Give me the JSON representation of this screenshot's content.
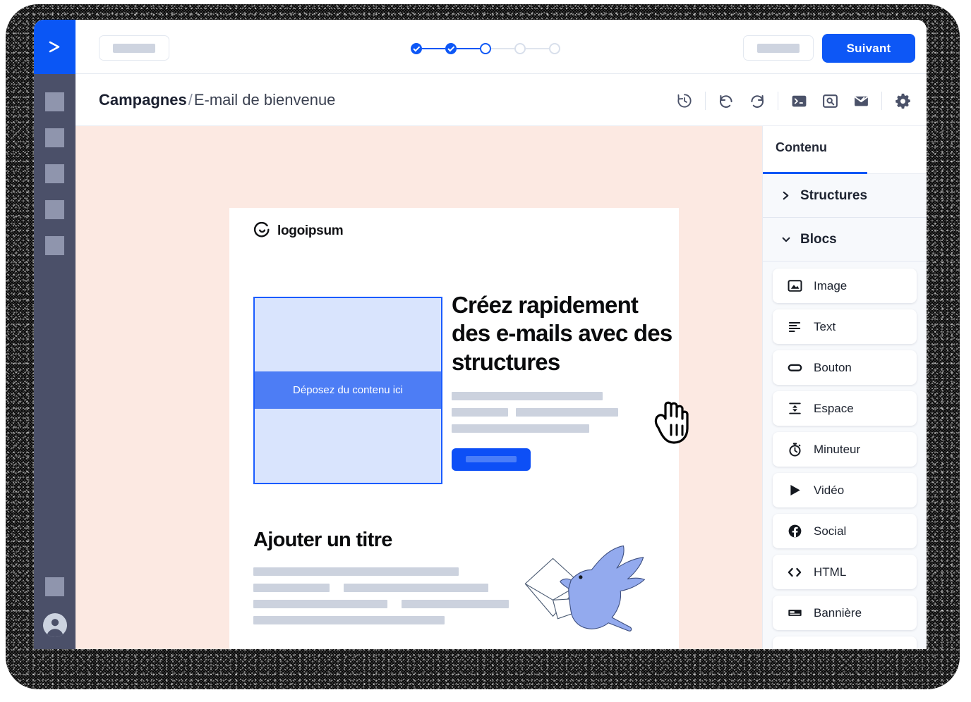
{
  "brand": {
    "logo_icon": "chevron-right-logo"
  },
  "topbar": {
    "left_button_placeholder": "",
    "right_button_placeholder": "",
    "next_label": "Suivant",
    "stepper": {
      "total_steps": 5,
      "steps": [
        {
          "state": "done"
        },
        {
          "state": "done"
        },
        {
          "state": "active"
        },
        {
          "state": "todo"
        },
        {
          "state": "todo"
        }
      ]
    }
  },
  "header": {
    "breadcrumb_root": "Campagnes",
    "breadcrumb_separator": "/",
    "breadcrumb_leaf": "E-mail de bienvenue",
    "tools": [
      {
        "name": "history-icon",
        "title": "Historique"
      },
      {
        "name": "undo-icon",
        "title": "Annuler"
      },
      {
        "name": "redo-icon",
        "title": "Rétablir"
      },
      {
        "name": "terminal-icon",
        "title": "Code"
      },
      {
        "name": "preview-icon",
        "title": "Aperçu"
      },
      {
        "name": "envelope-check-icon",
        "title": "Test"
      },
      {
        "name": "gear-icon",
        "title": "Paramètres"
      }
    ]
  },
  "rail": {
    "items": [
      {
        "name": "rail-item-1"
      },
      {
        "name": "rail-item-2"
      },
      {
        "name": "rail-item-3"
      },
      {
        "name": "rail-item-4"
      },
      {
        "name": "rail-item-5"
      },
      {
        "name": "rail-item-6"
      }
    ],
    "avatar_icon": "user-avatar-icon"
  },
  "canvas": {
    "background_color": "#fce9e2",
    "email": {
      "logo_text": "logoipsum",
      "logo_icon": "circle-arc-logo",
      "dropzone_label": "Déposez du contenu ici",
      "hero_heading": "Créez rapidement des e-mails avec des structures",
      "hero_bar_rows": [
        [
          214
        ],
        [
          80,
          145
        ],
        [
          195
        ]
      ],
      "cta_button_placeholder": "",
      "section_heading": "Ajouter un titre",
      "section_bar_rows": [
        [
          291
        ],
        [
          108,
          205
        ],
        [
          190,
          152
        ],
        [
          271
        ]
      ],
      "illustration": "bird-carrying-envelope"
    },
    "cursor_icon": "pointing-hand-cursor"
  },
  "panel": {
    "tab_label": "Contenu",
    "accordions": [
      {
        "label": "Structures",
        "expanded": false,
        "chevron": "chevron-right-icon"
      },
      {
        "label": "Blocs",
        "expanded": true,
        "chevron": "chevron-down-icon"
      }
    ],
    "blocks": [
      {
        "label": "Image",
        "icon": "image-icon"
      },
      {
        "label": "Text",
        "icon": "text-lines-icon"
      },
      {
        "label": "Bouton",
        "icon": "button-pill-icon"
      },
      {
        "label": "Espace",
        "icon": "spacer-arrows-icon"
      },
      {
        "label": "Minuteur",
        "icon": "timer-icon"
      },
      {
        "label": "Vidéo",
        "icon": "play-triangle-icon"
      },
      {
        "label": "Social",
        "icon": "facebook-icon"
      },
      {
        "label": "HTML",
        "icon": "code-brackets-icon"
      },
      {
        "label": "Bannière",
        "icon": "banner-icon"
      }
    ]
  },
  "colors": {
    "primary": "#0d57f6",
    "rail": "#4b5069",
    "canvas_bg": "#fce9e2",
    "dropzone_fill": "#d9e4fd",
    "dropzone_border": "#1a5cff",
    "dropzone_band": "#4d7df5",
    "placeholder_bar": "#ccd2de",
    "bird_fill": "#93aaee"
  }
}
